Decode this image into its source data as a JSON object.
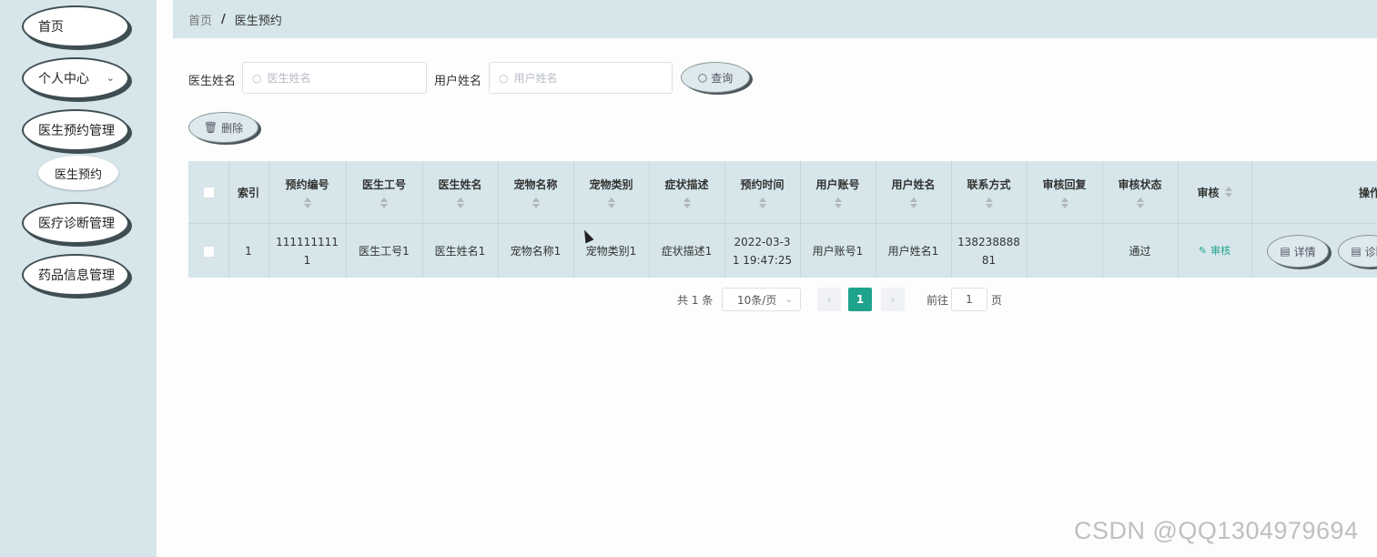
{
  "sidebar": {
    "items": [
      {
        "label": "首页"
      },
      {
        "label": "个人中心"
      },
      {
        "label": "医生预约管理"
      },
      {
        "label": "医疗诊断管理"
      },
      {
        "label": "药品信息管理"
      }
    ],
    "sub_item": {
      "label": "医生预约"
    }
  },
  "breadcrumb": {
    "home": "首页",
    "separator": "/",
    "current": "医生预约"
  },
  "search": {
    "doctor_name_label": "医生姓名",
    "doctor_name_placeholder": "医生姓名",
    "user_name_label": "用户姓名",
    "user_name_placeholder": "用户姓名",
    "query_label": "查询"
  },
  "toolbar": {
    "delete_label": "删除"
  },
  "table": {
    "headers": [
      "索引",
      "预约编号",
      "医生工号",
      "医生姓名",
      "宠物名称",
      "宠物类别",
      "症状描述",
      "预约时间",
      "用户账号",
      "用户姓名",
      "联系方式",
      "审核回复",
      "审核状态",
      "审核",
      "操作"
    ],
    "rows": [
      {
        "index": "1",
        "appointment_no": [
          "111111111",
          "1"
        ],
        "doctor_id": "医生工号1",
        "doctor_name": "医生姓名1",
        "pet_name": "宠物名称1",
        "pet_type": "宠物类别1",
        "symptom": "症状描述1",
        "appointment_time": [
          "2022-03-3",
          "1 19:47:25"
        ],
        "user_account": "用户账号1",
        "user_name": "用户姓名1",
        "contact": [
          "138238888",
          "81"
        ],
        "audit_reply": "",
        "audit_status": "通过",
        "audit_action": "审核",
        "detail_label": "详情",
        "diagnose_label": "诊断"
      }
    ]
  },
  "pagination": {
    "total": "共 1 条",
    "page_size": "10条/页",
    "prev": "‹",
    "current_page": "1",
    "next": "›",
    "goto_label": "前往",
    "goto_value": "1",
    "page_unit": "页"
  },
  "watermark": "CSDN @QQ1304979694",
  "colors": {
    "sidebar_bg": "#d6e6ea",
    "accent": "#1fa38c"
  }
}
